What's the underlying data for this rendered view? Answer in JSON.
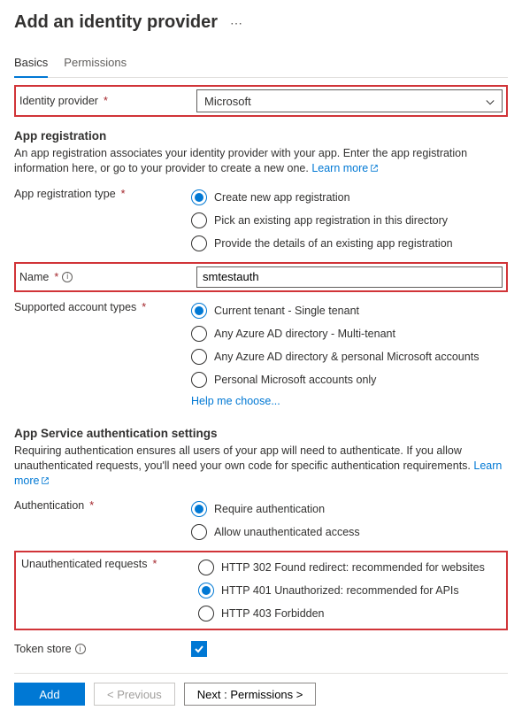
{
  "header": {
    "title": "Add an identity provider"
  },
  "tabs": {
    "basics": "Basics",
    "permissions": "Permissions"
  },
  "identity_provider": {
    "label": "Identity provider",
    "value": "Microsoft"
  },
  "app_reg": {
    "section_title": "App registration",
    "desc": "An app registration associates your identity provider with your app. Enter the app registration information here, or go to your provider to create a new one. ",
    "learn_more": "Learn more",
    "type_label": "App registration type",
    "type_options": {
      "create": "Create new app registration",
      "pick": "Pick an existing app registration in this directory",
      "details": "Provide the details of an existing app registration"
    },
    "type_selected": "create",
    "name_label": "Name",
    "name_value": "smtestauth",
    "acct_label": "Supported account types",
    "acct_options": {
      "single": "Current tenant - Single tenant",
      "multi": "Any Azure AD directory - Multi-tenant",
      "multi_personal": "Any Azure AD directory & personal Microsoft accounts",
      "personal": "Personal Microsoft accounts only"
    },
    "acct_selected": "single",
    "help_me_choose": "Help me choose..."
  },
  "auth": {
    "section_title": "App Service authentication settings",
    "desc": "Requiring authentication ensures all users of your app will need to authenticate. If you allow unauthenticated requests, you'll need your own code for specific authentication requirements. ",
    "learn_more": "Learn more",
    "auth_label": "Authentication",
    "auth_options": {
      "require": "Require authentication",
      "allow": "Allow unauthenticated access"
    },
    "auth_selected": "require",
    "unauth_label": "Unauthenticated requests",
    "unauth_options": {
      "r302": "HTTP 302 Found redirect: recommended for websites",
      "r401": "HTTP 401 Unauthorized: recommended for APIs",
      "r403": "HTTP 403 Forbidden"
    },
    "unauth_selected": "r401",
    "token_store_label": "Token store"
  },
  "footer": {
    "add": "Add",
    "prev": "< Previous",
    "next": "Next : Permissions >"
  }
}
